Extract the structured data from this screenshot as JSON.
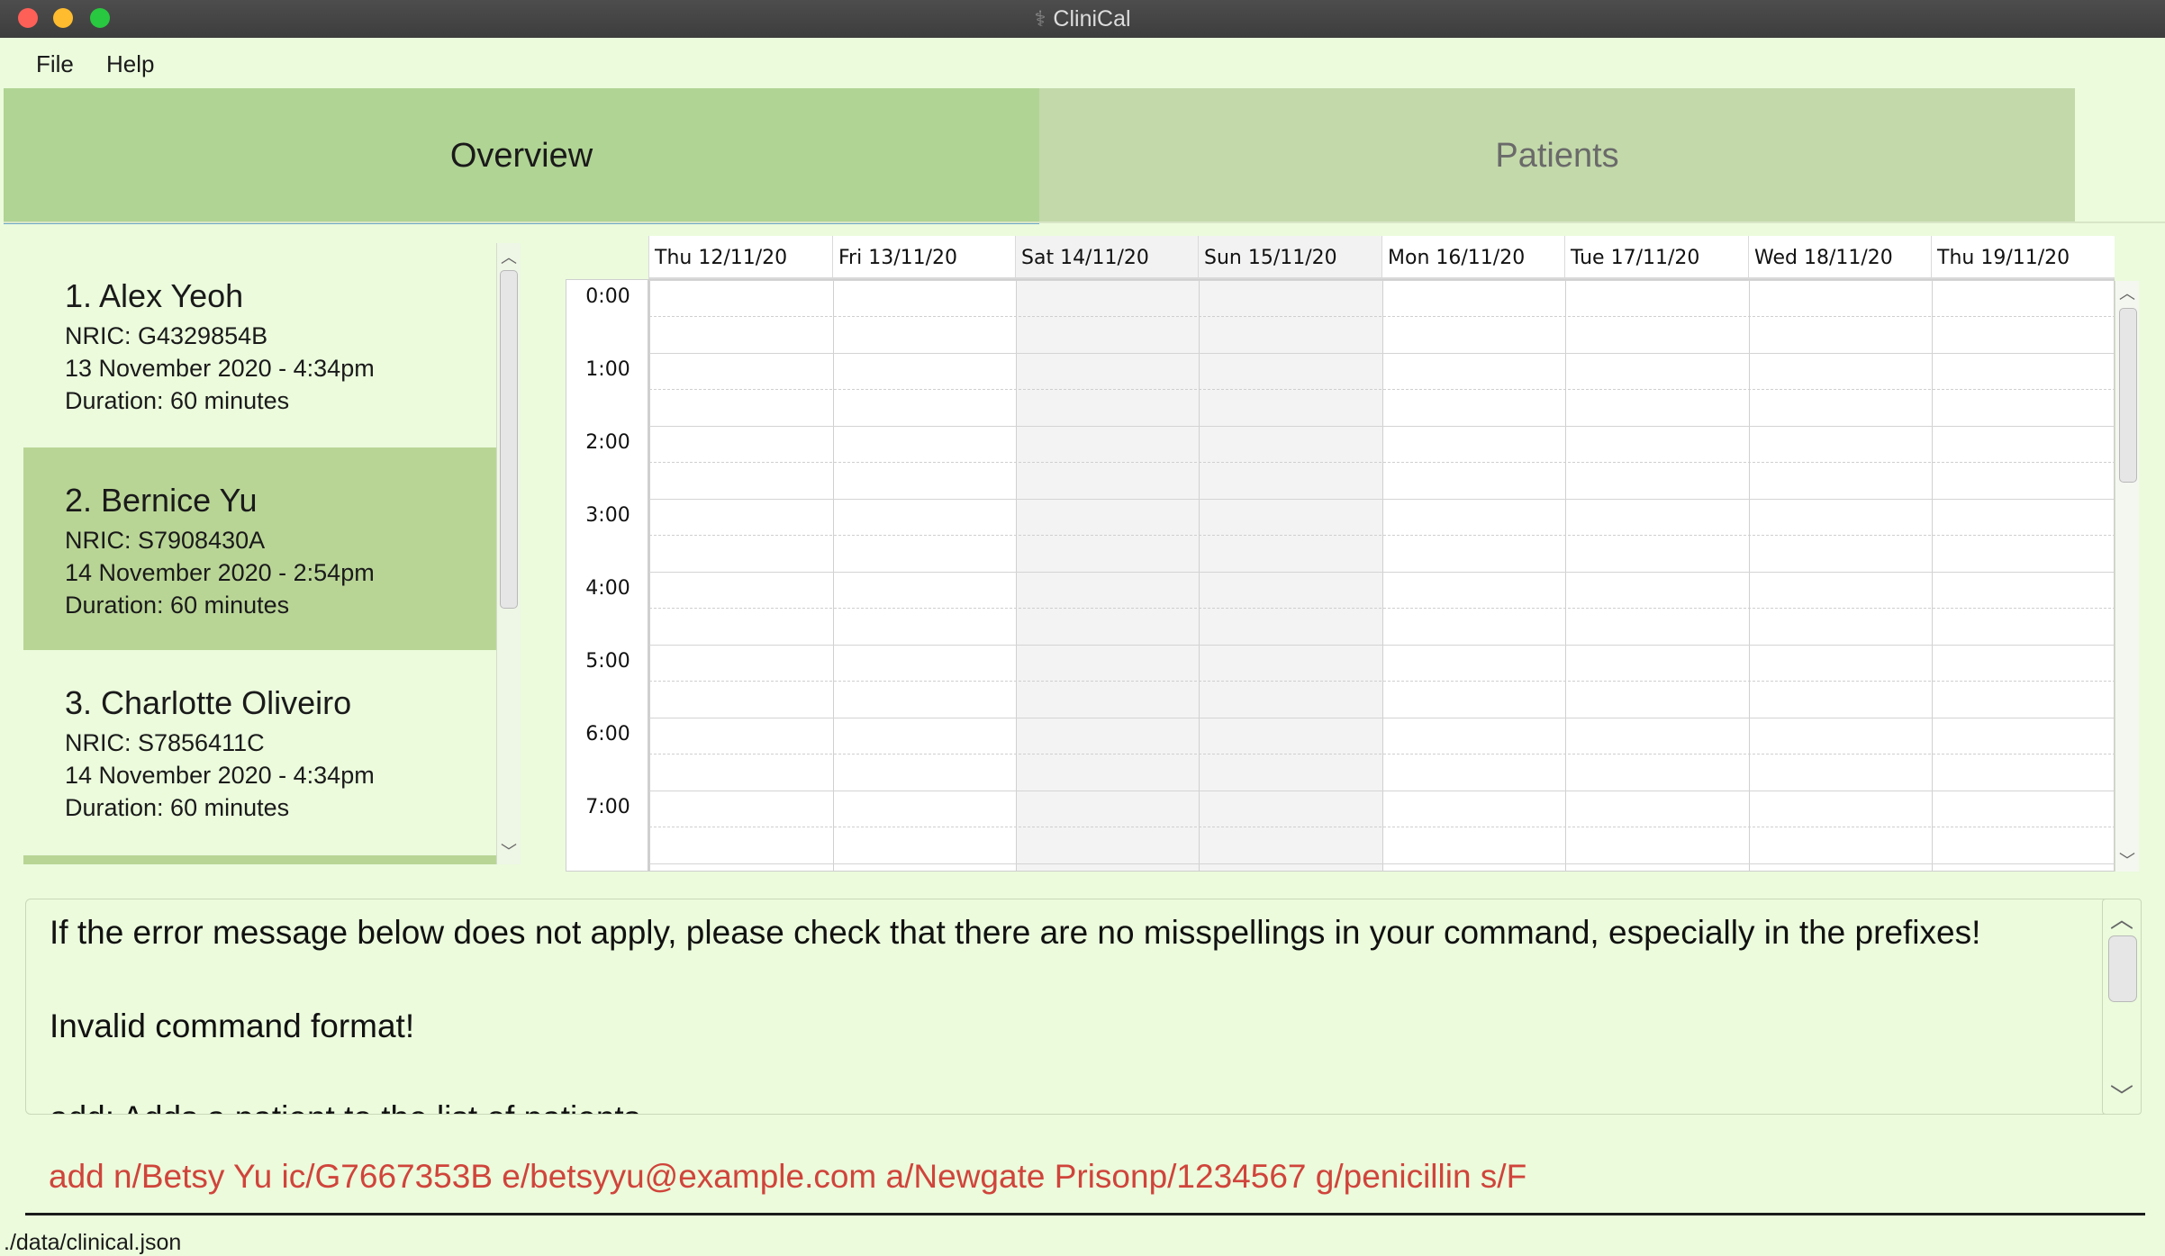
{
  "window": {
    "title": "CliniCal"
  },
  "menu": {
    "file": "File",
    "help": "Help"
  },
  "tabs": {
    "overview": "Overview",
    "patients": "Patients"
  },
  "appointments": [
    {
      "title": "1.  Alex Yeoh",
      "nric": "NRIC: G4329854B",
      "datetime": "13 November 2020 - 4:34pm",
      "duration": "Duration: 60 minutes"
    },
    {
      "title": "2.  Bernice Yu",
      "nric": "NRIC: S7908430A",
      "datetime": "14 November 2020 - 2:54pm",
      "duration": "Duration: 60 minutes"
    },
    {
      "title": "3.  Charlotte Oliveiro",
      "nric": "NRIC: S7856411C",
      "datetime": "14 November 2020 - 4:34pm",
      "duration": "Duration: 60 minutes"
    }
  ],
  "calendar": {
    "days": [
      "Thu 12/11/20",
      "Fri 13/11/20",
      "Sat 14/11/20",
      "Sun 15/11/20",
      "Mon 16/11/20",
      "Tue 17/11/20",
      "Wed 18/11/20",
      "Thu 19/11/20"
    ],
    "hours": [
      "0:00",
      "1:00",
      "2:00",
      "3:00",
      "4:00",
      "5:00",
      "6:00",
      "7:00"
    ]
  },
  "result": {
    "line1": "If the error message below does not apply, please check that there are no misspellings in your command, especially in the prefixes!",
    "line2": "Invalid command format!",
    "line3": "add: Adds a patient to the list of patients."
  },
  "command": {
    "value": "add n/Betsy Yu ic/G7667353B e/betsyyu@example.com a/Newgate Prisonp/1234567 g/penicillin s/F"
  },
  "status": {
    "path": "./data/clinical.json"
  }
}
